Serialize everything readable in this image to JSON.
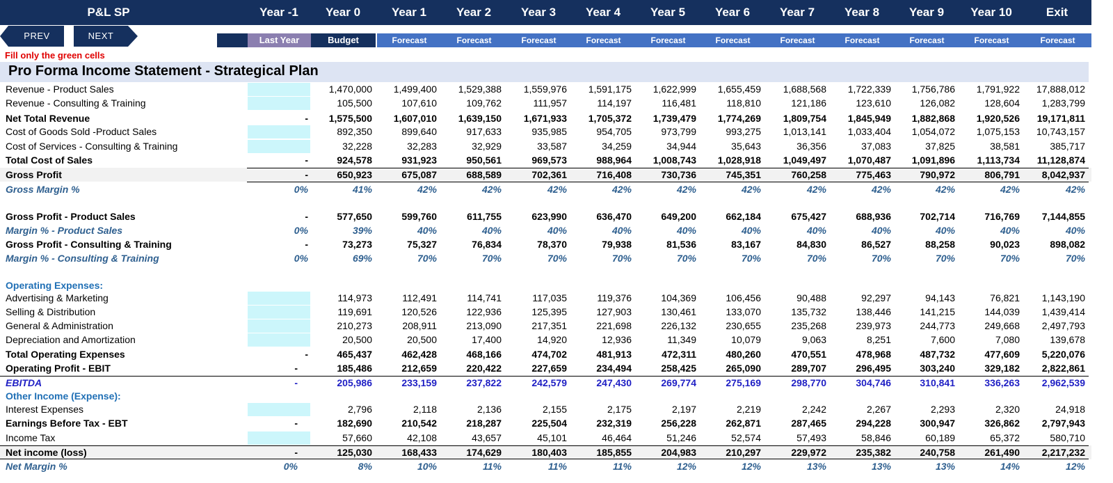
{
  "sheet_title": "P&L SP",
  "columns": [
    "Year -1",
    "Year 0",
    "Year 1",
    "Year 2",
    "Year 3",
    "Year 4",
    "Year 5",
    "Year 6",
    "Year 7",
    "Year 8",
    "Year 9",
    "Year 10",
    "Exit"
  ],
  "subheaders": [
    "Last Year",
    "Budget",
    "Forecast",
    "Forecast",
    "Forecast",
    "Forecast",
    "Forecast",
    "Forecast",
    "Forecast",
    "Forecast",
    "Forecast",
    "Forecast",
    "Forecast"
  ],
  "nav": {
    "prev": "PREV",
    "next": "NEXT"
  },
  "note": "Fill only the green cells",
  "statement_title": "Pro Forma Income Statement - Strategical Plan",
  "colors": {
    "header_bg": "#15305e",
    "last_year_bg": "#8b7fb0",
    "forecast_bg": "#4472c4",
    "green_cell": "#ccf6fb",
    "title_band": "#dde4f3",
    "note": "#e00000"
  },
  "rows": [
    {
      "label": "Revenue - Product Sales",
      "first": "",
      "values": [
        "1,470,000",
        "1,499,400",
        "1,529,388",
        "1,559,976",
        "1,591,175",
        "1,622,999",
        "1,655,459",
        "1,688,568",
        "1,722,339",
        "1,756,786",
        "1,791,922",
        "17,888,012"
      ]
    },
    {
      "label": "Revenue - Consulting & Training",
      "first": "",
      "values": [
        "105,500",
        "107,610",
        "109,762",
        "111,957",
        "114,197",
        "116,481",
        "118,810",
        "121,186",
        "123,610",
        "126,082",
        "128,604",
        "1,283,799"
      ]
    },
    {
      "label": "Net Total Revenue",
      "first": "-",
      "values": [
        "1,575,500",
        "1,607,010",
        "1,639,150",
        "1,671,933",
        "1,705,372",
        "1,739,479",
        "1,774,269",
        "1,809,754",
        "1,845,949",
        "1,882,868",
        "1,920,526",
        "19,171,811"
      ]
    },
    {
      "label": "Cost of Goods Sold -Product Sales",
      "first": "",
      "values": [
        "892,350",
        "899,640",
        "917,633",
        "935,985",
        "954,705",
        "973,799",
        "993,275",
        "1,013,141",
        "1,033,404",
        "1,054,072",
        "1,075,153",
        "10,743,157"
      ]
    },
    {
      "label": "Cost of Services - Consulting & Training",
      "first": "",
      "values": [
        "32,228",
        "32,283",
        "32,929",
        "33,587",
        "34,259",
        "34,944",
        "35,643",
        "36,356",
        "37,083",
        "37,825",
        "38,581",
        "385,717"
      ]
    },
    {
      "label": "Total Cost of Sales",
      "first": "-",
      "values": [
        "924,578",
        "931,923",
        "950,561",
        "969,573",
        "988,964",
        "1,008,743",
        "1,028,918",
        "1,049,497",
        "1,070,487",
        "1,091,896",
        "1,113,734",
        "11,128,874"
      ]
    },
    {
      "label": "Gross Profit",
      "first": "-",
      "values": [
        "650,923",
        "675,087",
        "688,589",
        "702,361",
        "716,408",
        "730,736",
        "745,351",
        "760,258",
        "775,463",
        "790,972",
        "806,791",
        "8,042,937"
      ]
    },
    {
      "label": "Gross Margin %",
      "first": "0%",
      "values": [
        "41%",
        "42%",
        "42%",
        "42%",
        "42%",
        "42%",
        "42%",
        "42%",
        "42%",
        "42%",
        "42%",
        "42%"
      ]
    },
    {
      "label": "Gross Profit - Product Sales",
      "first": "-",
      "values": [
        "577,650",
        "599,760",
        "611,755",
        "623,990",
        "636,470",
        "649,200",
        "662,184",
        "675,427",
        "688,936",
        "702,714",
        "716,769",
        "7,144,855"
      ]
    },
    {
      "label": "Margin % - Product Sales",
      "first": "0%",
      "values": [
        "39%",
        "40%",
        "40%",
        "40%",
        "40%",
        "40%",
        "40%",
        "40%",
        "40%",
        "40%",
        "40%",
        "40%"
      ]
    },
    {
      "label": "Gross Profit - Consulting & Training",
      "first": "-",
      "values": [
        "73,273",
        "75,327",
        "76,834",
        "78,370",
        "79,938",
        "81,536",
        "83,167",
        "84,830",
        "86,527",
        "88,258",
        "90,023",
        "898,082"
      ]
    },
    {
      "label": "Margin % - Consulting & Training",
      "first": "0%",
      "values": [
        "69%",
        "70%",
        "70%",
        "70%",
        "70%",
        "70%",
        "70%",
        "70%",
        "70%",
        "70%",
        "70%",
        "70%"
      ]
    },
    {
      "label": "Operating Expenses:",
      "first": "",
      "values": []
    },
    {
      "label": "Advertising & Marketing",
      "first": "",
      "values": [
        "114,973",
        "112,491",
        "114,741",
        "117,035",
        "119,376",
        "104,369",
        "106,456",
        "90,488",
        "92,297",
        "94,143",
        "76,821",
        "1,143,190"
      ]
    },
    {
      "label": "Selling & Distribution",
      "first": "",
      "values": [
        "119,691",
        "120,526",
        "122,936",
        "125,395",
        "127,903",
        "130,461",
        "133,070",
        "135,732",
        "138,446",
        "141,215",
        "144,039",
        "1,439,414"
      ]
    },
    {
      "label": "General & Administration",
      "first": "",
      "values": [
        "210,273",
        "208,911",
        "213,090",
        "217,351",
        "221,698",
        "226,132",
        "230,655",
        "235,268",
        "239,973",
        "244,773",
        "249,668",
        "2,497,793"
      ]
    },
    {
      "label": "Depreciation and Amortization",
      "first": "",
      "values": [
        "20,500",
        "20,500",
        "17,400",
        "14,920",
        "12,936",
        "11,349",
        "10,079",
        "9,063",
        "8,251",
        "7,600",
        "7,080",
        "139,678"
      ]
    },
    {
      "label": "Total Operating Expenses",
      "first": "-",
      "values": [
        "465,437",
        "462,428",
        "468,166",
        "474,702",
        "481,913",
        "472,311",
        "480,260",
        "470,551",
        "478,968",
        "487,732",
        "477,609",
        "5,220,076"
      ]
    },
    {
      "label": "Operating Profit - EBIT",
      "first": "-",
      "values": [
        "185,486",
        "212,659",
        "220,422",
        "227,659",
        "234,494",
        "258,425",
        "265,090",
        "289,707",
        "296,495",
        "303,240",
        "329,182",
        "2,822,861"
      ]
    },
    {
      "label": "EBITDA",
      "first": "-",
      "values": [
        "205,986",
        "233,159",
        "237,822",
        "242,579",
        "247,430",
        "269,774",
        "275,169",
        "298,770",
        "304,746",
        "310,841",
        "336,263",
        "2,962,539"
      ]
    },
    {
      "label": "Other Income (Expense):",
      "first": "",
      "values": []
    },
    {
      "label": "Interest Expenses",
      "first": "",
      "values": [
        "2,796",
        "2,118",
        "2,136",
        "2,155",
        "2,175",
        "2,197",
        "2,219",
        "2,242",
        "2,267",
        "2,293",
        "2,320",
        "24,918"
      ]
    },
    {
      "label": "Earnings Before Tax - EBT",
      "first": "-",
      "values": [
        "182,690",
        "210,542",
        "218,287",
        "225,504",
        "232,319",
        "256,228",
        "262,871",
        "287,465",
        "294,228",
        "300,947",
        "326,862",
        "2,797,943"
      ]
    },
    {
      "label": "Income Tax",
      "first": "",
      "values": [
        "57,660",
        "42,108",
        "43,657",
        "45,101",
        "46,464",
        "51,246",
        "52,574",
        "57,493",
        "58,846",
        "60,189",
        "65,372",
        "580,710"
      ]
    },
    {
      "label": "Net income (loss)",
      "first": "-",
      "values": [
        "125,030",
        "168,433",
        "174,629",
        "180,403",
        "185,855",
        "204,983",
        "210,297",
        "229,972",
        "235,382",
        "240,758",
        "261,490",
        "2,217,232"
      ]
    },
    {
      "label": "Net Margin %",
      "first": "0%",
      "values": [
        "8%",
        "10%",
        "11%",
        "11%",
        "11%",
        "12%",
        "12%",
        "13%",
        "13%",
        "13%",
        "14%",
        "12%"
      ]
    }
  ]
}
